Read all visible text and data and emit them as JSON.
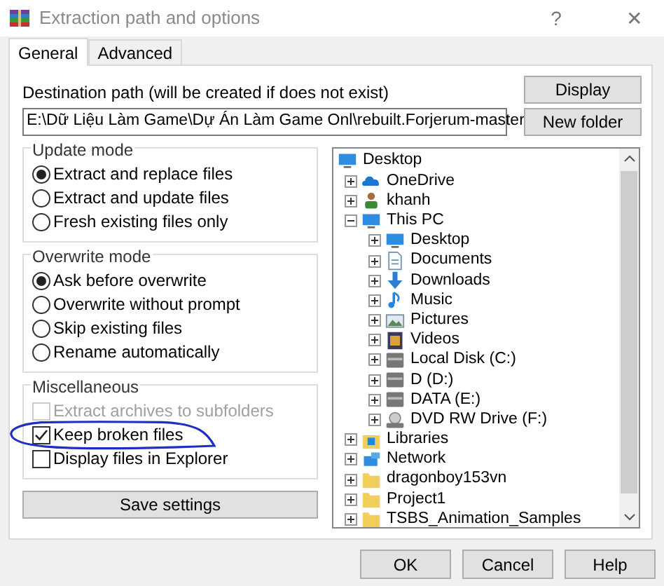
{
  "window": {
    "title": "Extraction path and options",
    "help": "?",
    "close": "✕"
  },
  "tabs": [
    {
      "label": "General",
      "selected": true
    },
    {
      "label": "Advanced",
      "selected": false
    }
  ],
  "destination": {
    "label": "Destination path (will be created if does not exist)",
    "value": "E:\\Dữ Liệu Làm Game\\Dự Án Làm Game Onl\\rebuilt.Forjerum-master"
  },
  "side_buttons": [
    "Display",
    "New folder"
  ],
  "update_mode": {
    "title": "Update mode",
    "options": [
      {
        "label": "Extract and replace files",
        "selected": true
      },
      {
        "label": "Extract and update files",
        "selected": false
      },
      {
        "label": "Fresh existing files only",
        "selected": false
      }
    ]
  },
  "overwrite_mode": {
    "title": "Overwrite mode",
    "options": [
      {
        "label": "Ask before overwrite",
        "selected": true
      },
      {
        "label": "Overwrite without prompt",
        "selected": false
      },
      {
        "label": "Skip existing files",
        "selected": false
      },
      {
        "label": "Rename automatically",
        "selected": false
      }
    ]
  },
  "miscellaneous": {
    "title": "Miscellaneous",
    "options": [
      {
        "label": "Extract archives to subfolders",
        "checked": false,
        "disabled": true
      },
      {
        "label": "Keep broken files",
        "checked": true,
        "disabled": false
      },
      {
        "label": "Display files in Explorer",
        "checked": false,
        "disabled": false
      }
    ]
  },
  "save_button": "Save settings",
  "folder_tree": [
    {
      "label": "Desktop",
      "kind": "monitor",
      "children": [
        {
          "label": "OneDrive",
          "kind": "cloud",
          "expanded": false
        },
        {
          "label": "khanh",
          "kind": "person",
          "expanded": false
        },
        {
          "label": "This PC",
          "kind": "monitor",
          "expanded": true,
          "children": [
            {
              "label": "Desktop",
              "kind": "monitor",
              "expanded": false
            },
            {
              "label": "Documents",
              "kind": "document",
              "expanded": false
            },
            {
              "label": "Downloads",
              "kind": "download",
              "expanded": false
            },
            {
              "label": "Music",
              "kind": "music",
              "expanded": false
            },
            {
              "label": "Pictures",
              "kind": "pictures",
              "expanded": false
            },
            {
              "label": "Videos",
              "kind": "videos",
              "expanded": false
            },
            {
              "label": "Local Disk (C:)",
              "kind": "disk",
              "expanded": false
            },
            {
              "label": "D (D:)",
              "kind": "disk",
              "expanded": false
            },
            {
              "label": "DATA (E:)",
              "kind": "disk",
              "expanded": false
            },
            {
              "label": "DVD RW Drive (F:)",
              "kind": "dvd",
              "expanded": false
            }
          ]
        },
        {
          "label": "Libraries",
          "kind": "library",
          "expanded": false
        },
        {
          "label": "Network",
          "kind": "network",
          "expanded": false
        },
        {
          "label": "dragonboy153vn",
          "kind": "folder",
          "expanded": false
        },
        {
          "label": "Project1",
          "kind": "folder",
          "expanded": false
        },
        {
          "label": "TSBS_Animation_Samples",
          "kind": "folder",
          "expanded": false
        }
      ]
    }
  ],
  "dialog_buttons": [
    "OK",
    "Cancel",
    "Help"
  ]
}
